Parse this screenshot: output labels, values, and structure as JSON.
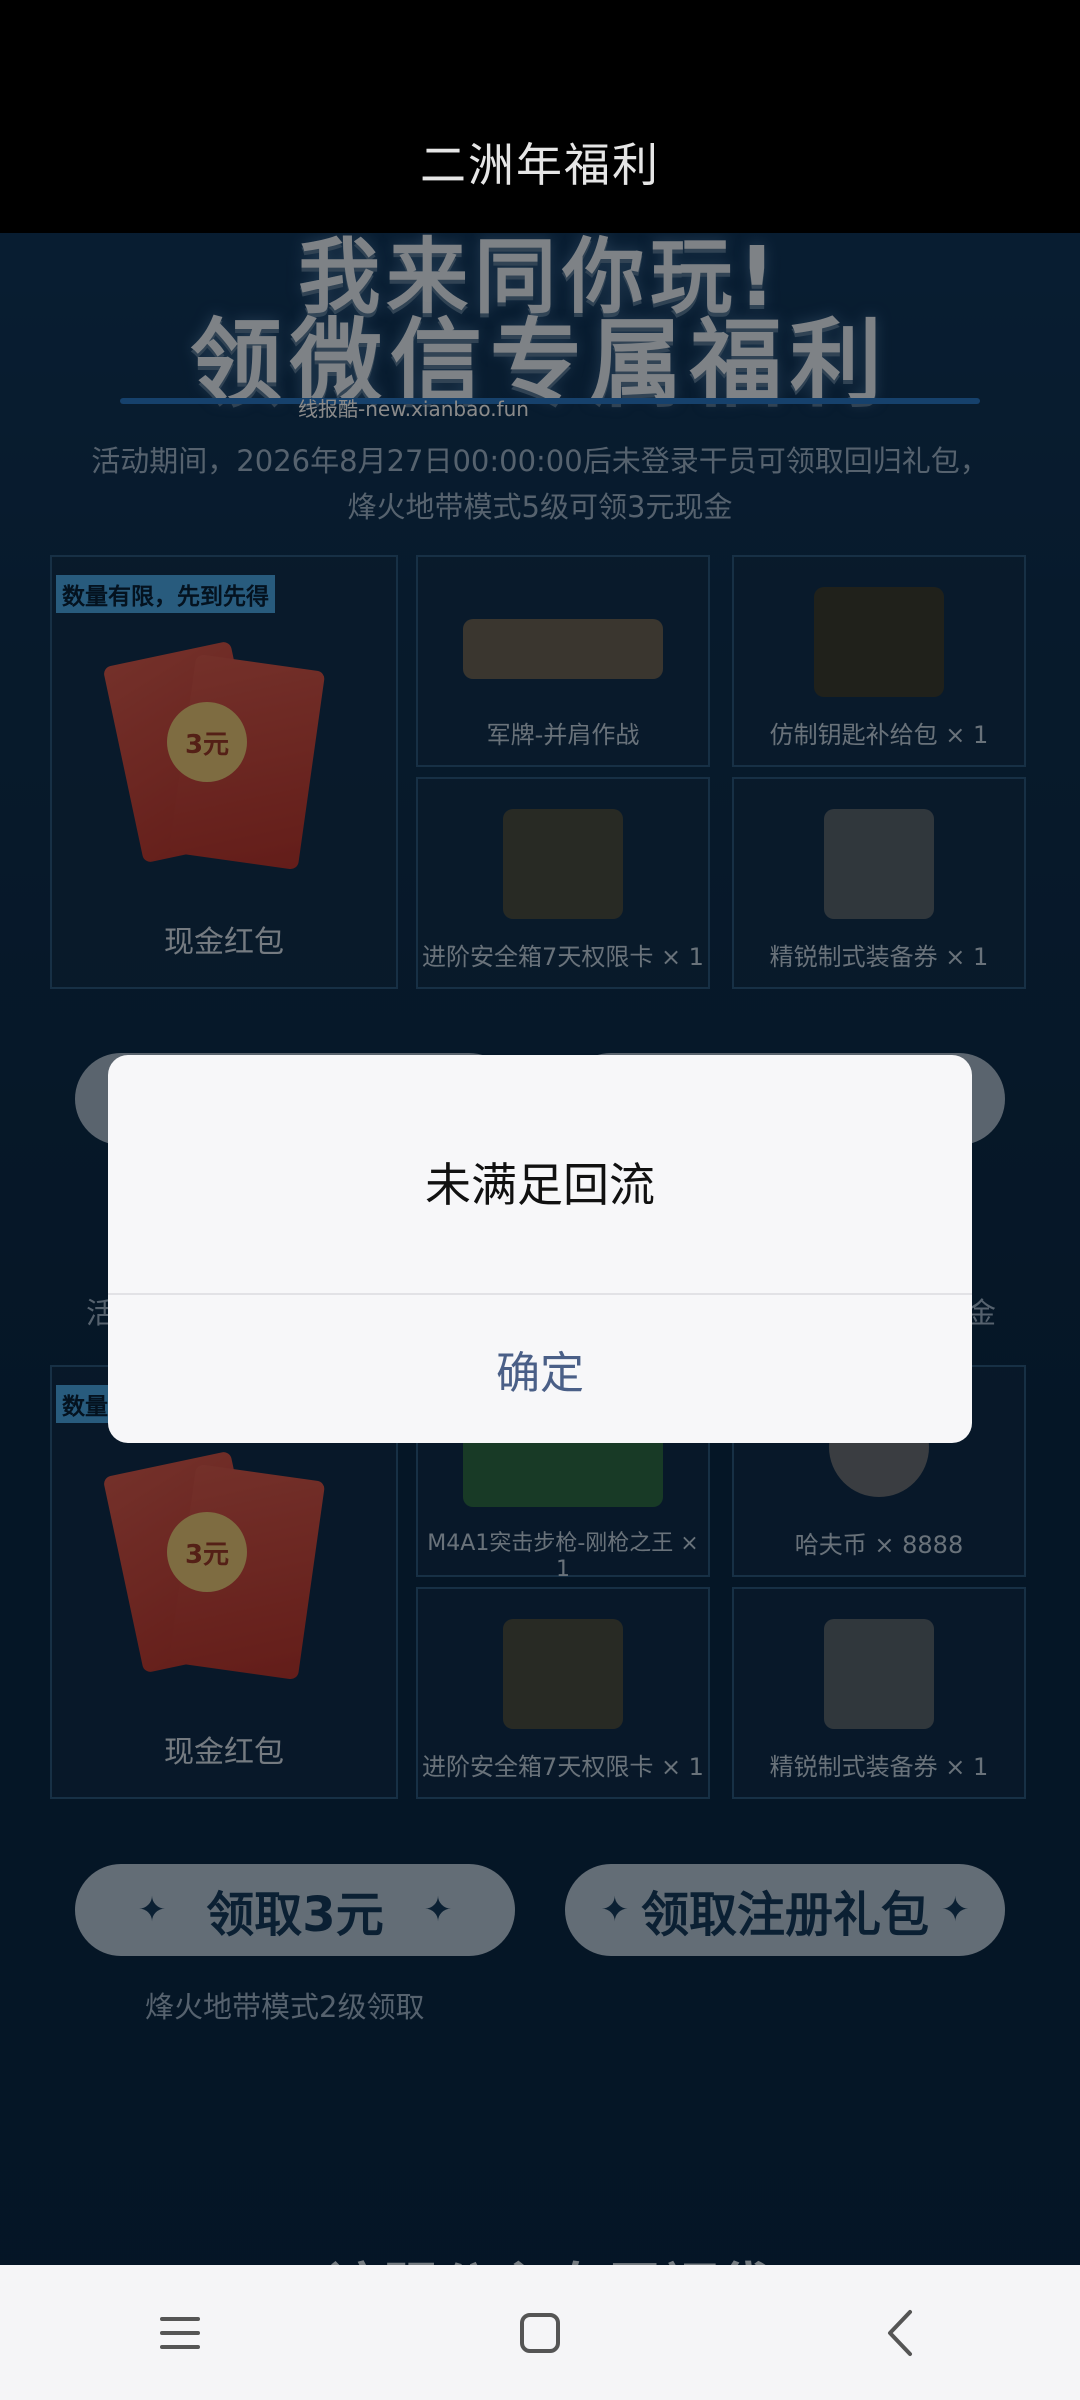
{
  "header": {
    "title": "二洲年福利"
  },
  "hero": {
    "line1": "我来同你玩!",
    "line2": "领微信专属福利",
    "watermark": "线报酷-new.xianbao.fun",
    "description_line1": "活动期间，2026年8月27日00:00:00后未登录干员可领取回归礼包，",
    "description_line2": "烽火地带模式5级可领3元现金"
  },
  "section1": {
    "tag": "数量有限，先到先得",
    "big_item": {
      "label": "现金红包",
      "coin": "3元"
    },
    "items": [
      {
        "label": "军牌-并肩作战"
      },
      {
        "label": "仿制钥匙补给包 × 1"
      },
      {
        "label": "进阶安全箱7天权限卡 × 1"
      },
      {
        "label": "精锐制式装备券 × 1"
      }
    ]
  },
  "section2": {
    "tag": "数量",
    "big_item": {
      "label": "现金红包",
      "coin": "3元"
    },
    "items": [
      {
        "label": "M4A1突击步枪-刚枪之王 × 1"
      },
      {
        "label": "哈夫币 × 8888"
      },
      {
        "label": "进阶安全箱7天权限卡 × 1"
      },
      {
        "label": "精锐制式装备券 × 1"
      }
    ],
    "note_fragment_left": "活",
    "note_fragment_right": "金"
  },
  "actions": {
    "claim_3": "领取3元",
    "claim_register": "领取注册礼包",
    "note": "烽火地带模式2级领取"
  },
  "footer_banner": "该服公主专属福袋",
  "dialog": {
    "message": "未满足回流",
    "confirm": "确定"
  },
  "nav": {
    "menu": "menu",
    "home": "home",
    "back": "back"
  }
}
